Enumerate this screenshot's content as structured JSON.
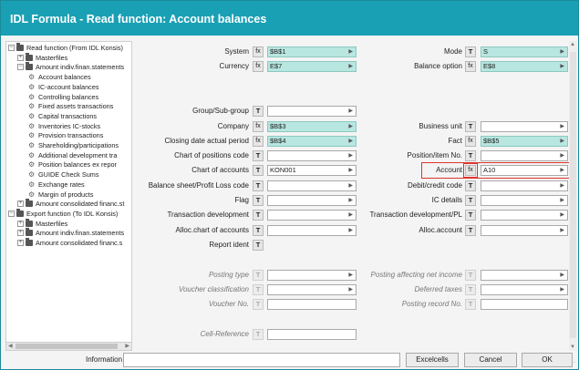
{
  "window": {
    "title": "IDL Formula - Read function: Account balances"
  },
  "tree": {
    "items": [
      {
        "label": "Read function (From IDL Konsis)",
        "level": 0,
        "kind": "folder",
        "expander": "−"
      },
      {
        "label": "Masterfiles",
        "level": 1,
        "kind": "folder",
        "expander": "+"
      },
      {
        "label": "Amount indiv.finan.statements",
        "level": 1,
        "kind": "folder",
        "expander": "−"
      },
      {
        "label": "Account balances",
        "level": 2,
        "kind": "gear"
      },
      {
        "label": "IC-account balances",
        "level": 2,
        "kind": "gear"
      },
      {
        "label": "Controlling balances",
        "level": 2,
        "kind": "gear"
      },
      {
        "label": "Fixed assets transactions",
        "level": 2,
        "kind": "gear"
      },
      {
        "label": "Capital transactions",
        "level": 2,
        "kind": "gear"
      },
      {
        "label": "Inventories IC-stocks",
        "level": 2,
        "kind": "gear"
      },
      {
        "label": "Provision transactions",
        "level": 2,
        "kind": "gear"
      },
      {
        "label": "Shareholding/participations",
        "level": 2,
        "kind": "gear"
      },
      {
        "label": "Additional development tra",
        "level": 2,
        "kind": "gear"
      },
      {
        "label": "Position balances ex repor",
        "level": 2,
        "kind": "gear"
      },
      {
        "label": "GUIDE Check Sums",
        "level": 2,
        "kind": "gear"
      },
      {
        "label": "Exchange rates",
        "level": 2,
        "kind": "gear"
      },
      {
        "label": "Margin of products",
        "level": 2,
        "kind": "gear"
      },
      {
        "label": "Amount consolidated financ.st",
        "level": 1,
        "kind": "folder",
        "expander": "+"
      },
      {
        "label": "Export function (To IDL Konsis)",
        "level": 0,
        "kind": "folder",
        "expander": "−"
      },
      {
        "label": "Masterfiles",
        "level": 1,
        "kind": "folder",
        "expander": "+"
      },
      {
        "label": "Amount indiv.finan.statements",
        "level": 1,
        "kind": "folder",
        "expander": "+"
      },
      {
        "label": "Amount consolidated financ.s",
        "level": 1,
        "kind": "folder",
        "expander": "+"
      }
    ]
  },
  "form": {
    "left": [
      {
        "label": "System",
        "btn": "fx",
        "value": "$B$1",
        "teal": true,
        "row": 0
      },
      {
        "label": "Currency",
        "btn": "fx",
        "value": "E$7",
        "teal": true,
        "row": 1
      },
      {
        "label": "Group/Sub-group",
        "btn": "T",
        "value": "",
        "teal": false,
        "row": 4
      },
      {
        "label": "Company",
        "btn": "fx",
        "value": "$B$3",
        "teal": true,
        "row": 5
      },
      {
        "label": "Closing date actual period",
        "btn": "fx",
        "value": "$B$4",
        "teal": true,
        "row": 6
      },
      {
        "label": "Chart of positions code",
        "btn": "T",
        "value": "",
        "teal": false,
        "row": 7
      },
      {
        "label": "Chart of accounts",
        "btn": "T",
        "value": "KON001",
        "teal": false,
        "row": 8
      },
      {
        "label": "Balance sheet/Profit  Loss code",
        "btn": "T",
        "value": "",
        "teal": false,
        "row": 9
      },
      {
        "label": "Flag",
        "btn": "T",
        "value": "",
        "teal": false,
        "row": 10
      },
      {
        "label": "Transaction development",
        "btn": "T",
        "value": "",
        "teal": false,
        "row": 11
      },
      {
        "label": "Alloc.chart of accounts",
        "btn": "T",
        "value": "",
        "teal": false,
        "row": 12
      },
      {
        "label": "Report ident",
        "btn": "T",
        "value": "",
        "teal": false,
        "row": 13,
        "nofield": true
      },
      {
        "label": "Posting type",
        "btn": "T",
        "value": "",
        "teal": false,
        "row": 15,
        "dim": true
      },
      {
        "label": "Voucher classification",
        "btn": "T",
        "value": "",
        "teal": false,
        "row": 16,
        "dim": true
      },
      {
        "label": "Voucher No.",
        "btn": "T",
        "value": "",
        "teal": false,
        "row": 17,
        "dim": true,
        "plain": true
      },
      {
        "label": "Cell-Reference",
        "btn": "T",
        "value": "",
        "teal": false,
        "row": 19,
        "dim": true,
        "plain": true
      }
    ],
    "right": [
      {
        "label": "Mode",
        "btn": "T",
        "value": "S",
        "teal": true,
        "row": 0
      },
      {
        "label": "Balance option",
        "btn": "fx",
        "value": "E$8",
        "teal": true,
        "row": 1
      },
      {
        "label": "Business unit",
        "btn": "T",
        "value": "",
        "teal": false,
        "row": 5
      },
      {
        "label": "Fact",
        "btn": "fx",
        "value": "$B$5",
        "teal": true,
        "row": 6
      },
      {
        "label": "Position/item No.",
        "btn": "T",
        "value": "",
        "teal": false,
        "row": 7
      },
      {
        "label": "Account",
        "btn": "fx",
        "value": "A10",
        "teal": false,
        "row": 8,
        "highlight": true
      },
      {
        "label": "Debit/credit code",
        "btn": "T",
        "value": "",
        "teal": false,
        "row": 9
      },
      {
        "label": "IC details",
        "btn": "T",
        "value": "",
        "teal": false,
        "row": 10
      },
      {
        "label": "Transaction development/PL",
        "btn": "T",
        "value": "",
        "teal": false,
        "row": 11
      },
      {
        "label": "Alloc.account",
        "btn": "T",
        "value": "",
        "teal": false,
        "row": 12
      },
      {
        "label": "Posting affecting net income",
        "btn": "T",
        "value": "",
        "teal": false,
        "row": 15,
        "dim": true
      },
      {
        "label": "Deferred taxes",
        "btn": "T",
        "value": "",
        "teal": false,
        "row": 16,
        "dim": true
      },
      {
        "label": "Posting record No.",
        "btn": "T",
        "value": "",
        "teal": false,
        "row": 17,
        "dim": true,
        "plain": true
      }
    ]
  },
  "bottom": {
    "info_label": "Information",
    "info_value": "",
    "excelcells": "Excelcells",
    "cancel": "Cancel",
    "ok": "OK"
  },
  "icons": {
    "dropdown": "dropdown-arrow-icon",
    "folder": "folder-icon",
    "gear": "gear-icon"
  },
  "colors": {
    "titlebar": "#1aa0b4",
    "teal_field": "#b8e6e0",
    "highlight": "#e0342c"
  }
}
